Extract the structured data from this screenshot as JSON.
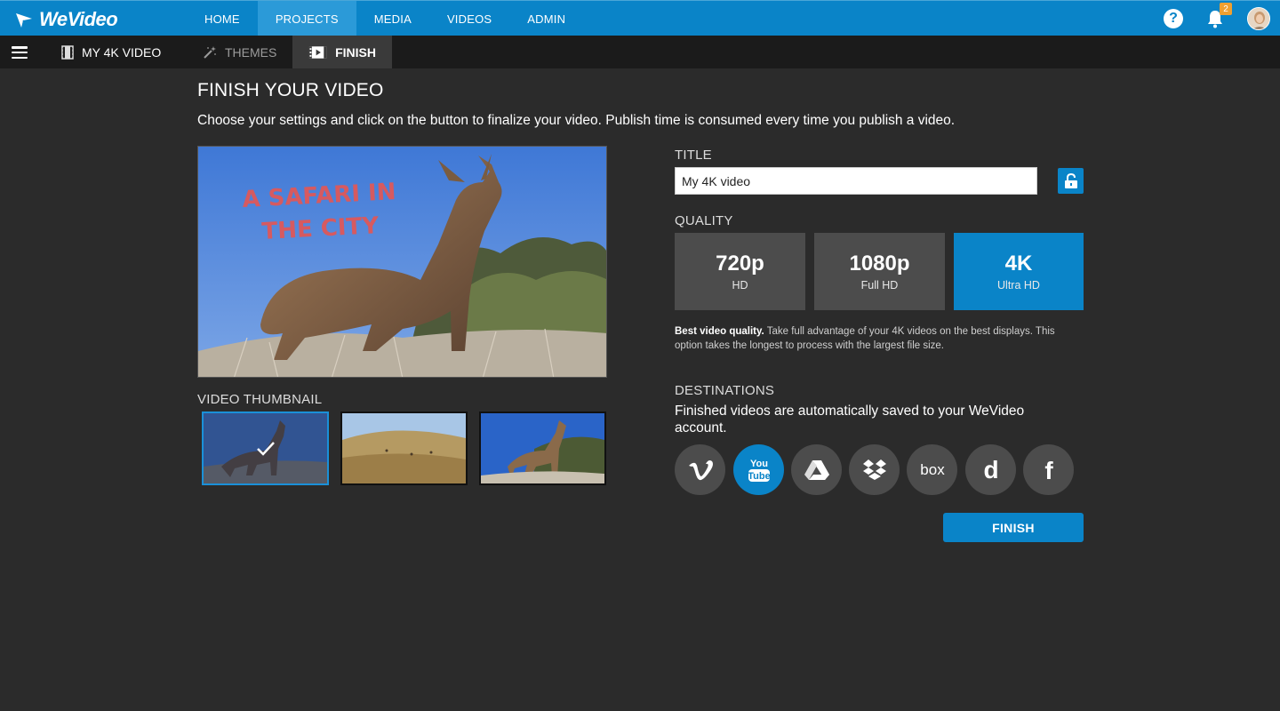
{
  "brand": {
    "name": "WeVideo"
  },
  "nav": {
    "items": [
      {
        "label": "HOME"
      },
      {
        "label": "PROJECTS",
        "active": true
      },
      {
        "label": "MEDIA"
      },
      {
        "label": "VIDEOS"
      },
      {
        "label": "ADMIN"
      }
    ]
  },
  "header": {
    "help_label": "?",
    "notification_count": "2"
  },
  "subnav": {
    "project_label": "MY 4K VIDEO",
    "themes_label": "THEMES",
    "finish_label": "FINISH"
  },
  "main": {
    "title": "FINISH YOUR VIDEO",
    "description": "Choose your settings and click on the button to finalize your video. Publish time is consumed every time you publish a video.",
    "preview_overlay": [
      "A SAFARI IN",
      "THE CITY"
    ],
    "thumbnail_label": "VIDEO THUMBNAIL",
    "title_label": "TITLE",
    "title_value": "My 4K video",
    "quality_label": "QUALITY",
    "quality_options": [
      {
        "main": "720p",
        "sub": "HD"
      },
      {
        "main": "1080p",
        "sub": "Full HD"
      },
      {
        "main": "4K",
        "sub": "Ultra HD",
        "selected": true
      }
    ],
    "quality_desc_bold": "Best video quality.",
    "quality_desc": " Take full advantage of your 4K videos on the best displays. This option takes the longest to process with the largest file size.",
    "destinations_label": "DESTINATIONS",
    "destinations_desc": "Finished videos are automatically saved to your WeVideo account.",
    "destinations": [
      {
        "icon": "vimeo-icon"
      },
      {
        "icon": "youtube-icon",
        "selected": true
      },
      {
        "icon": "google-drive-icon"
      },
      {
        "icon": "dropbox-icon"
      },
      {
        "icon": "box-icon"
      },
      {
        "icon": "dailymotion-icon"
      },
      {
        "icon": "facebook-icon"
      }
    ],
    "finish_button": "FINISH"
  },
  "colors": {
    "accent": "#0a84c8",
    "background": "#2b2b2b",
    "subbar": "#1b1b1b",
    "tile": "#4c4c4c",
    "badge": "#f0a030"
  }
}
